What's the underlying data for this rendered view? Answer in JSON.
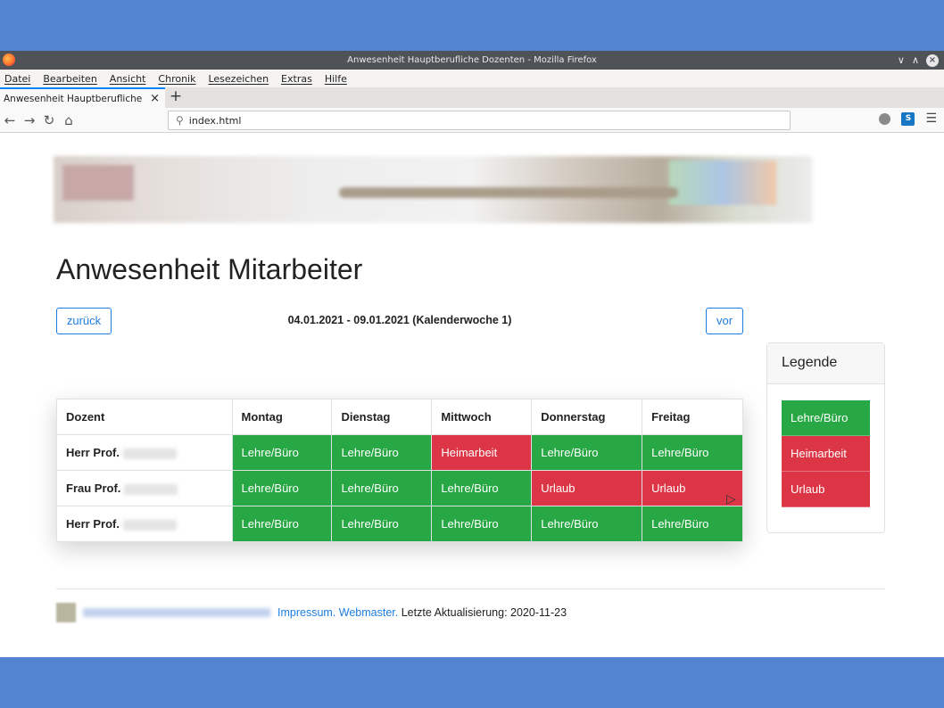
{
  "window": {
    "title": "Anwesenheit Hauptberufliche Dozenten - Mozilla Firefox"
  },
  "menu": [
    "Datei",
    "Bearbeiten",
    "Ansicht",
    "Chronik",
    "Lesezeichen",
    "Extras",
    "Hilfe"
  ],
  "tab": {
    "label": "Anwesenheit Hauptberufliche"
  },
  "url": {
    "value": "index.html"
  },
  "page": {
    "heading": "Anwesenheit Mitarbeiter",
    "back_label": "zurück",
    "forward_label": "vor",
    "range": "04.01.2021 - 09.01.2021 (Kalenderwoche 1)"
  },
  "table": {
    "headers": [
      "Dozent",
      "Montag",
      "Dienstag",
      "Mittwoch",
      "Donnerstag",
      "Freitag"
    ],
    "rows": [
      {
        "name": "Herr Prof.",
        "cells": [
          {
            "text": "Lehre/Büro",
            "status": "green"
          },
          {
            "text": "Lehre/Büro",
            "status": "green"
          },
          {
            "text": "Heimarbeit",
            "status": "red"
          },
          {
            "text": "Lehre/Büro",
            "status": "green"
          },
          {
            "text": "Lehre/Büro",
            "status": "green"
          }
        ]
      },
      {
        "name": "Frau Prof.",
        "cells": [
          {
            "text": "Lehre/Büro",
            "status": "green"
          },
          {
            "text": "Lehre/Büro",
            "status": "green"
          },
          {
            "text": "Lehre/Büro",
            "status": "green"
          },
          {
            "text": "Urlaub",
            "status": "red"
          },
          {
            "text": "Urlaub",
            "status": "red"
          }
        ]
      },
      {
        "name": "Herr Prof.",
        "cells": [
          {
            "text": "Lehre/Büro",
            "status": "green"
          },
          {
            "text": "Lehre/Büro",
            "status": "green"
          },
          {
            "text": "Lehre/Büro",
            "status": "green"
          },
          {
            "text": "Lehre/Büro",
            "status": "green"
          },
          {
            "text": "Lehre/Büro",
            "status": "green"
          }
        ]
      }
    ]
  },
  "legend": {
    "title": "Legende",
    "items": [
      {
        "text": "Lehre/Büro",
        "status": "green"
      },
      {
        "text": "Heimarbeit",
        "status": "red"
      },
      {
        "text": "Urlaub",
        "status": "red"
      }
    ]
  },
  "footer": {
    "impressum": "Impressum.",
    "webmaster": "Webmaster.",
    "updated": "Letzte Aktualisierung: 2020-11-23"
  },
  "colors": {
    "green": "#28a745",
    "red": "#dc3545",
    "link": "#1e7ee0"
  }
}
